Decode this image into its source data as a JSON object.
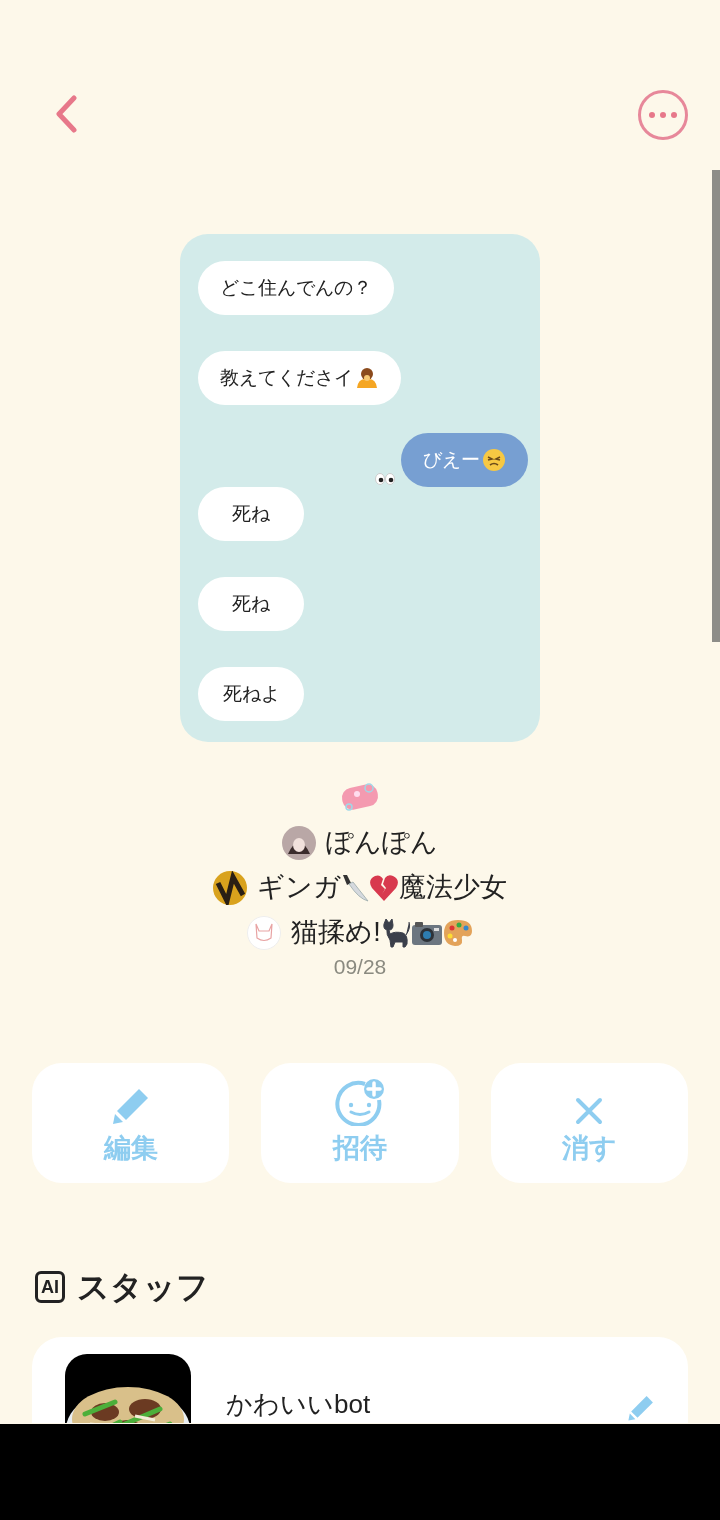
{
  "messages": [
    {
      "text": "どこ住んでんの？",
      "sent": false
    },
    {
      "text": "教えてくださイ",
      "sent": false
    },
    {
      "text": "びえー",
      "sent": true
    },
    {
      "text": "死ね",
      "sent": false
    },
    {
      "text": "死ね",
      "sent": false
    },
    {
      "text": "死ねよ",
      "sent": false
    }
  ],
  "members": [
    {
      "name": "ぽんぽん"
    },
    {
      "name": "ギンガ",
      "tag": "魔法少女"
    },
    {
      "name": "猫揉め!"
    }
  ],
  "date": "09/28",
  "actions": [
    {
      "label": "編集"
    },
    {
      "label": "招待"
    },
    {
      "label": "消す"
    }
  ],
  "section": {
    "badge": "AI",
    "title": "スタッフ"
  },
  "staff": [
    {
      "name": "かわいいbot"
    }
  ]
}
